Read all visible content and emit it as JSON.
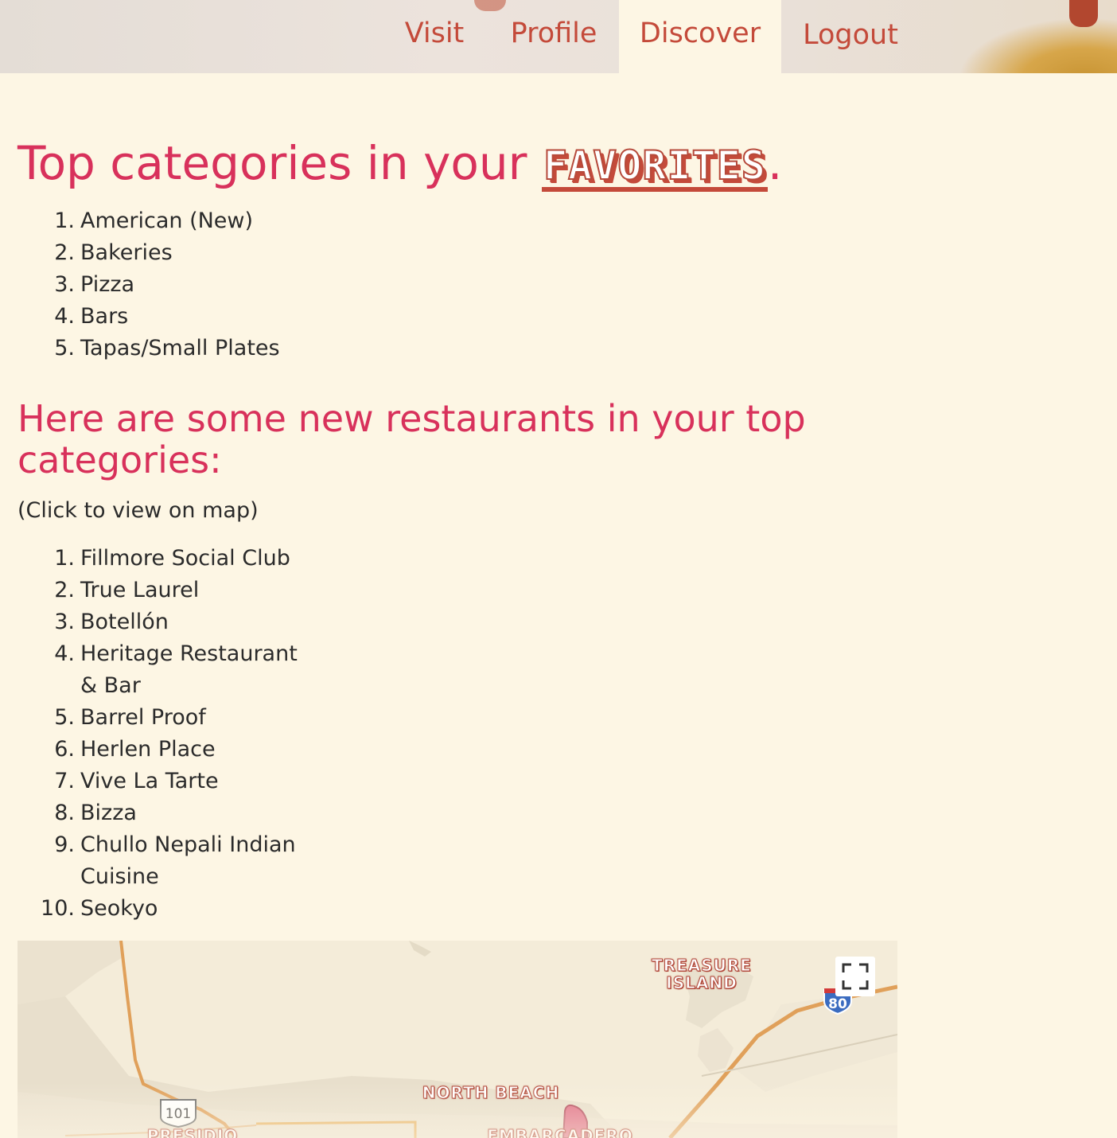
{
  "nav": {
    "visit": "Visit",
    "profile": "Profile",
    "discover": "Discover",
    "logout": "Logout",
    "active": "Discover"
  },
  "favorites_heading": {
    "prefix": "Top categories in your ",
    "emphasis": "FAVORITES",
    "suffix": "."
  },
  "top_categories": [
    {
      "num": "1.",
      "label": "American (New)"
    },
    {
      "num": "2.",
      "label": "Bakeries"
    },
    {
      "num": "3.",
      "label": "Pizza"
    },
    {
      "num": "4.",
      "label": "Bars"
    },
    {
      "num": "5.",
      "label": "Tapas/Small Plates"
    }
  ],
  "restaurants_heading": "Here are some new restaurants in your top categories:",
  "restaurants_hint": "(Click to view on map)",
  "restaurants": [
    {
      "num": "1.",
      "label": "Fillmore Social Club"
    },
    {
      "num": "2.",
      "label": "True Laurel"
    },
    {
      "num": "3.",
      "label": "Botellón"
    },
    {
      "num": "4.",
      "label": "Heritage Restaurant & Bar"
    },
    {
      "num": "5.",
      "label": "Barrel Proof"
    },
    {
      "num": "6.",
      "label": "Herlen Place"
    },
    {
      "num": "7.",
      "label": "Vive La Tarte"
    },
    {
      "num": "8.",
      "label": "Bizza"
    },
    {
      "num": "9.",
      "label": "Chullo Nepali Indian Cuisine"
    },
    {
      "num": "10.",
      "label": "Seokyo"
    }
  ],
  "map": {
    "labels": {
      "treasure_island": "TREASURE ISLAND",
      "north_beach": "NORTH BEACH",
      "presidio": "PRESIDIO",
      "embarcadero": "EMBARCADERO"
    },
    "shields": {
      "us101": "101",
      "i80": "80"
    },
    "fullscreen_icon": "fullscreen-icon",
    "colors": {
      "water": "#f4ecd9",
      "land": "#e8dfcc",
      "road": "#e0a05a",
      "marker": "#e06f86"
    }
  },
  "colors": {
    "accent": "#d8315b",
    "nav": "#c44a3a",
    "background": "#fdf6e4"
  }
}
